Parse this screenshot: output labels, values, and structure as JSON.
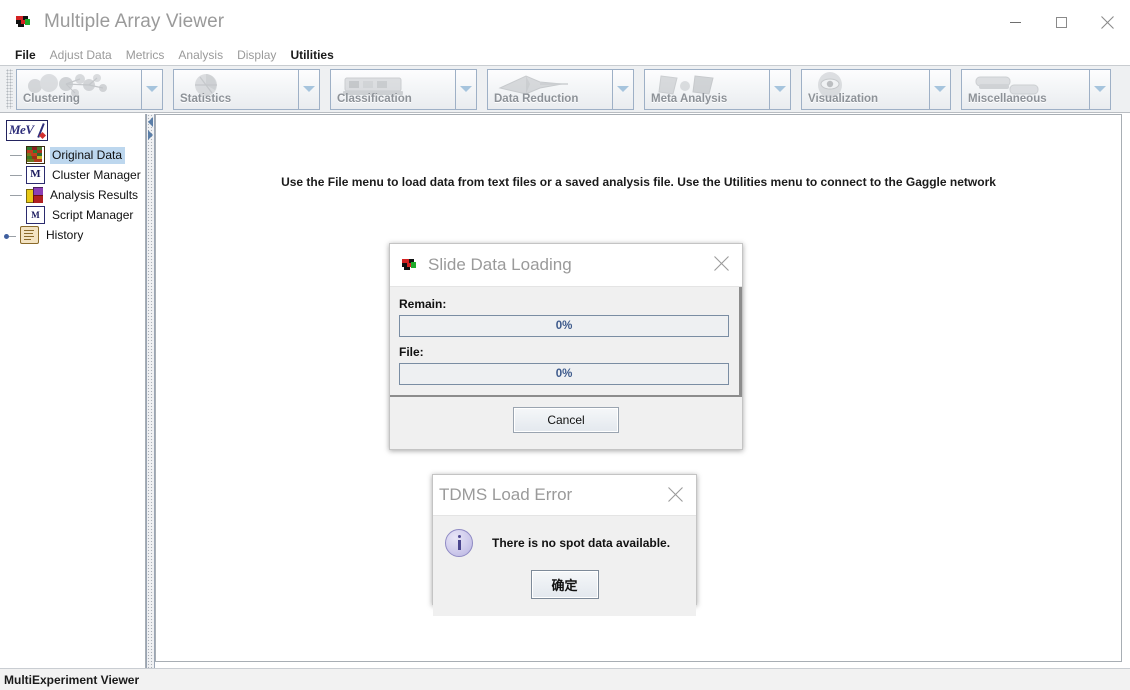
{
  "window": {
    "title": "Multiple Array Viewer",
    "icon": "mev-heatmap-icon",
    "controls": {
      "minimize": "minimize-icon",
      "maximize": "maximize-icon",
      "close": "close-icon"
    }
  },
  "menubar": {
    "items": [
      {
        "label": "File",
        "enabled": true
      },
      {
        "label": "Adjust Data",
        "enabled": false
      },
      {
        "label": "Metrics",
        "enabled": false
      },
      {
        "label": "Analysis",
        "enabled": false
      },
      {
        "label": "Display",
        "enabled": false
      },
      {
        "label": "Utilities",
        "enabled": true
      }
    ]
  },
  "toolbar": {
    "buttons": [
      {
        "label": "Clustering",
        "icon": "clustering-icon"
      },
      {
        "label": "Statistics",
        "icon": "statistics-icon"
      },
      {
        "label": "Classification",
        "icon": "classification-icon"
      },
      {
        "label": "Data Reduction",
        "icon": "data-reduction-icon"
      },
      {
        "label": "Meta Analysis",
        "icon": "meta-analysis-icon"
      },
      {
        "label": "Visualization",
        "icon": "visualization-icon"
      },
      {
        "label": "Miscellaneous",
        "icon": "miscellaneous-icon"
      }
    ]
  },
  "sidebar": {
    "root_label": "MeV",
    "items": [
      {
        "label": "Original Data",
        "icon": "heatmap-icon",
        "selected": true
      },
      {
        "label": "Cluster Manager",
        "icon": "cluster-manager-icon",
        "selected": false
      },
      {
        "label": "Analysis Results",
        "icon": "analysis-results-icon",
        "selected": false
      },
      {
        "label": "Script Manager",
        "icon": "script-manager-icon",
        "selected": false
      },
      {
        "label": "History",
        "icon": "history-scroll-icon",
        "selected": false
      }
    ]
  },
  "main": {
    "hint": "Use the File menu to load data from text files or a saved analysis file. Use the Utilities menu to connect to the Gaggle network"
  },
  "statusbar": {
    "text": "MultiExperiment Viewer"
  },
  "slide_dialog": {
    "title": "Slide Data Loading",
    "icon": "mev-heatmap-icon",
    "close": "close-icon",
    "remain_label": "Remain:",
    "remain_value": "0%",
    "file_label": "File:",
    "file_value": "0%",
    "cancel_label": "Cancel"
  },
  "error_dialog": {
    "title": "TDMS Load Error",
    "close": "close-icon",
    "icon": "info-icon",
    "message": "There is no spot data available.",
    "ok_label": "确定"
  },
  "colors": {
    "accent": "#3d5a8c",
    "selection": "#bdd7ee",
    "toolbar_bg": "#eef0f2",
    "info_icon": "#b7b2e0"
  }
}
